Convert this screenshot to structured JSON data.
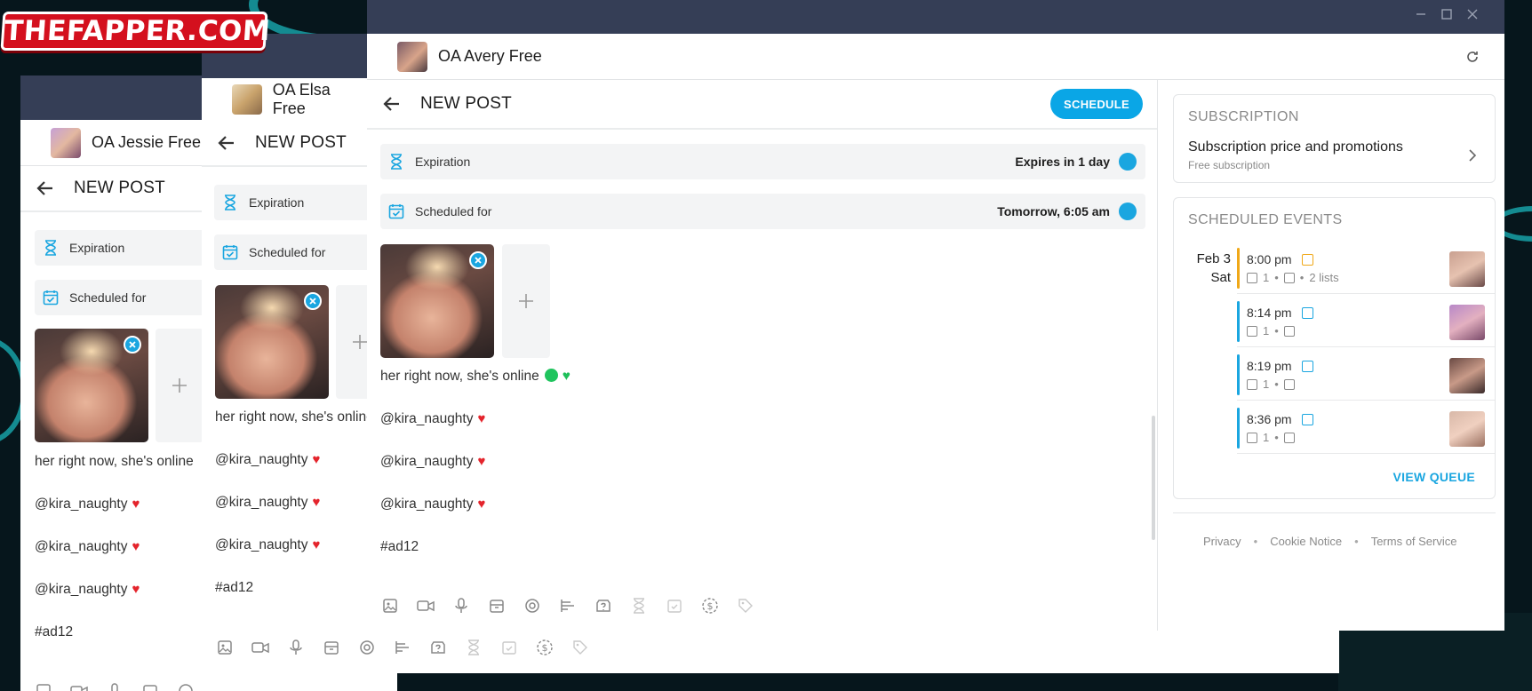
{
  "watermark": "THEFAPPER.COM",
  "windows": {
    "jessie": {
      "account": "OA Jessie Free",
      "new_post": "NEW POST",
      "expiration_label": "Expiration",
      "scheduled_label": "Scheduled for",
      "text_lines": [
        "her right now, she's online",
        "@kira_naughty",
        "@kira_naughty",
        "@kira_naughty",
        "#ad12"
      ]
    },
    "elsa": {
      "account": "OA Elsa Free",
      "new_post": "NEW POST",
      "expiration_label": "Expiration",
      "scheduled_label": "Scheduled for",
      "text_lines": [
        "her right now, she's online",
        "@kira_naughty",
        "@kira_naughty",
        "@kira_naughty",
        "#ad12"
      ]
    },
    "avery": {
      "account": "OA Avery Free",
      "new_post": "NEW POST",
      "schedule_btn": "SCHEDULE",
      "expiration_label": "Expiration",
      "expiration_value": "Expires in 1 day",
      "scheduled_label": "Scheduled for",
      "scheduled_value": "Tomorrow, 6:05 am",
      "text_lines": [
        "her right now, she's online",
        "@kira_naughty",
        "@kira_naughty",
        "@kira_naughty",
        "#ad12"
      ]
    }
  },
  "subscription": {
    "heading": "SUBSCRIPTION",
    "title": "Subscription price and promotions",
    "subtitle": "Free subscription"
  },
  "scheduled_events": {
    "heading": "SCHEDULED EVENTS",
    "date_day": "Feb 3",
    "date_weekday": "Sat",
    "events": [
      {
        "time": "8:00 pm",
        "count": "1",
        "lists": "2 lists",
        "color": "#f0a818"
      },
      {
        "time": "8:14 pm",
        "count": "1",
        "lists": "",
        "color": "#1aa6e0"
      },
      {
        "time": "8:19 pm",
        "count": "1",
        "lists": "",
        "color": "#1aa6e0"
      },
      {
        "time": "8:36 pm",
        "count": "1",
        "lists": "",
        "color": "#1aa6e0"
      }
    ],
    "view_queue": "VIEW QUEUE"
  },
  "footer": {
    "privacy": "Privacy",
    "cookie": "Cookie Notice",
    "terms": "Terms of Service"
  },
  "colors": {
    "accent": "#1aa6e0",
    "titlebar": "#353e56",
    "heart": "#e4242c"
  }
}
